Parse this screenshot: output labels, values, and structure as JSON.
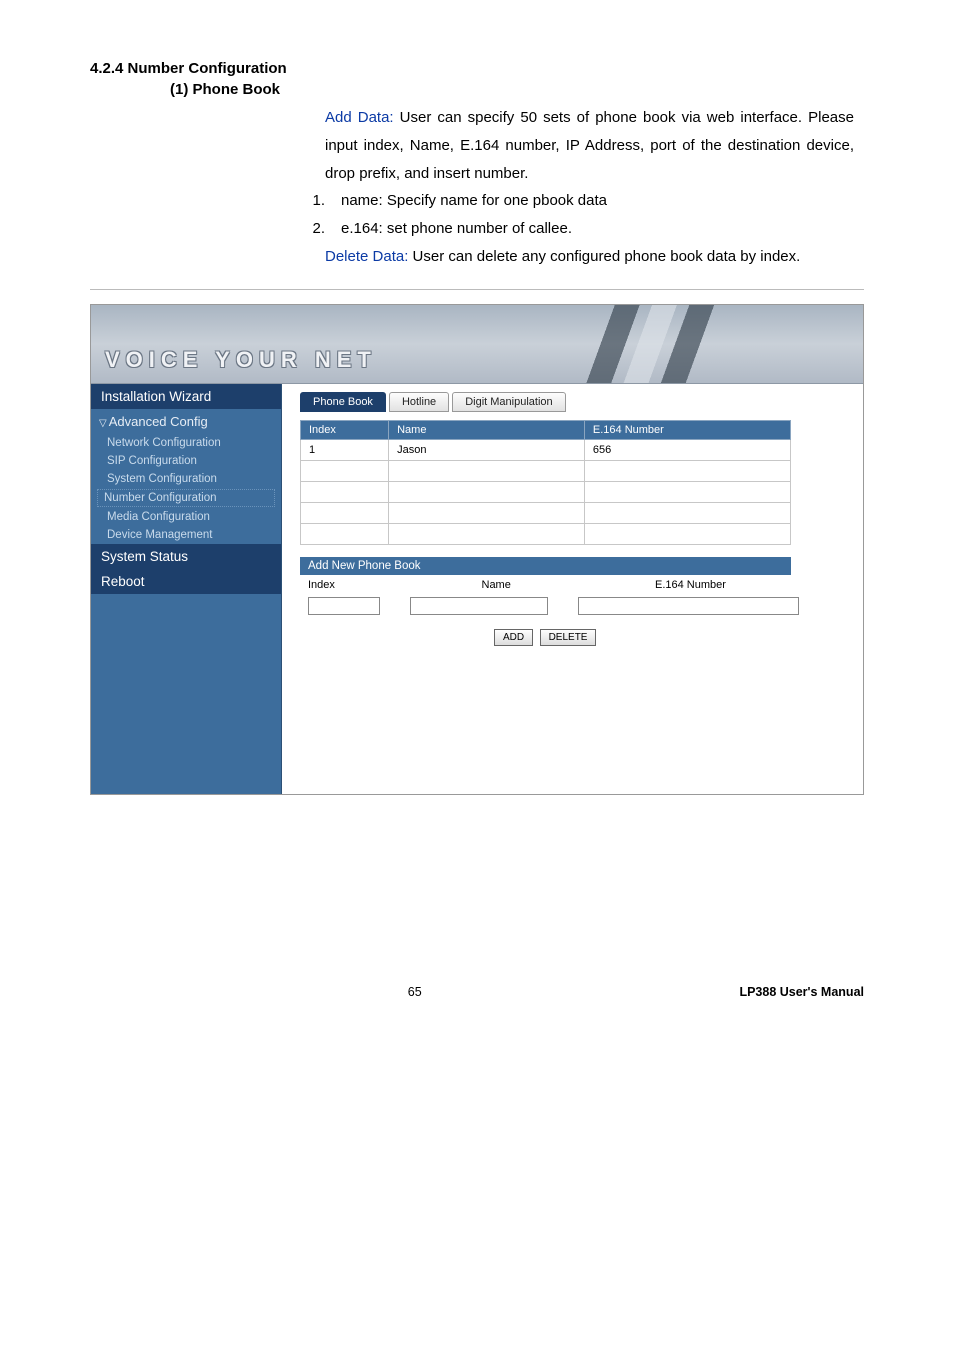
{
  "doc": {
    "section_title": "4.2.4 Number Configuration",
    "sub_title": "(1) Phone Book",
    "add_data_label": "Add Data: ",
    "add_data_text": "User can specify 50 sets of phone book via web interface. Please input index, Name, E.164 number, IP Address, port of the destination device, drop prefix, and insert number.",
    "list1_num": "1.",
    "list1_text": "name: Specify name for one pbook data",
    "list2_num": "2.",
    "list2_text": "e.164: set phone number of callee.",
    "delete_data_label": "Delete Data: ",
    "delete_data_text": "User can delete any configured phone book data by index."
  },
  "banner": {
    "text": "VOICE YOUR NET"
  },
  "sidebar": {
    "install": "Installation Wizard",
    "advanced": "Advanced Config",
    "items": {
      "network": "Network Configuration",
      "sip": "SIP Configuration",
      "system": "System Configuration",
      "number": "Number Configuration",
      "media": "Media Configuration",
      "device": "Device Management"
    },
    "status": "System Status",
    "reboot": "Reboot"
  },
  "tabs": {
    "phonebook": "Phone Book",
    "hotline": "Hotline",
    "digit": "Digit Manipulation"
  },
  "grid": {
    "headers": {
      "index": "Index",
      "name": "Name",
      "e164": "E.164 Number"
    },
    "row1": {
      "index": "1",
      "name": "Jason",
      "e164": "656"
    }
  },
  "addsection": {
    "title": "Add New Phone Book",
    "cols": {
      "index": "Index",
      "name": "Name",
      "e164": "E.164 Number"
    },
    "buttons": {
      "add": "ADD",
      "delete": "DELETE"
    }
  },
  "footer": {
    "page": "65",
    "manual": "LP388  User's  Manual"
  }
}
